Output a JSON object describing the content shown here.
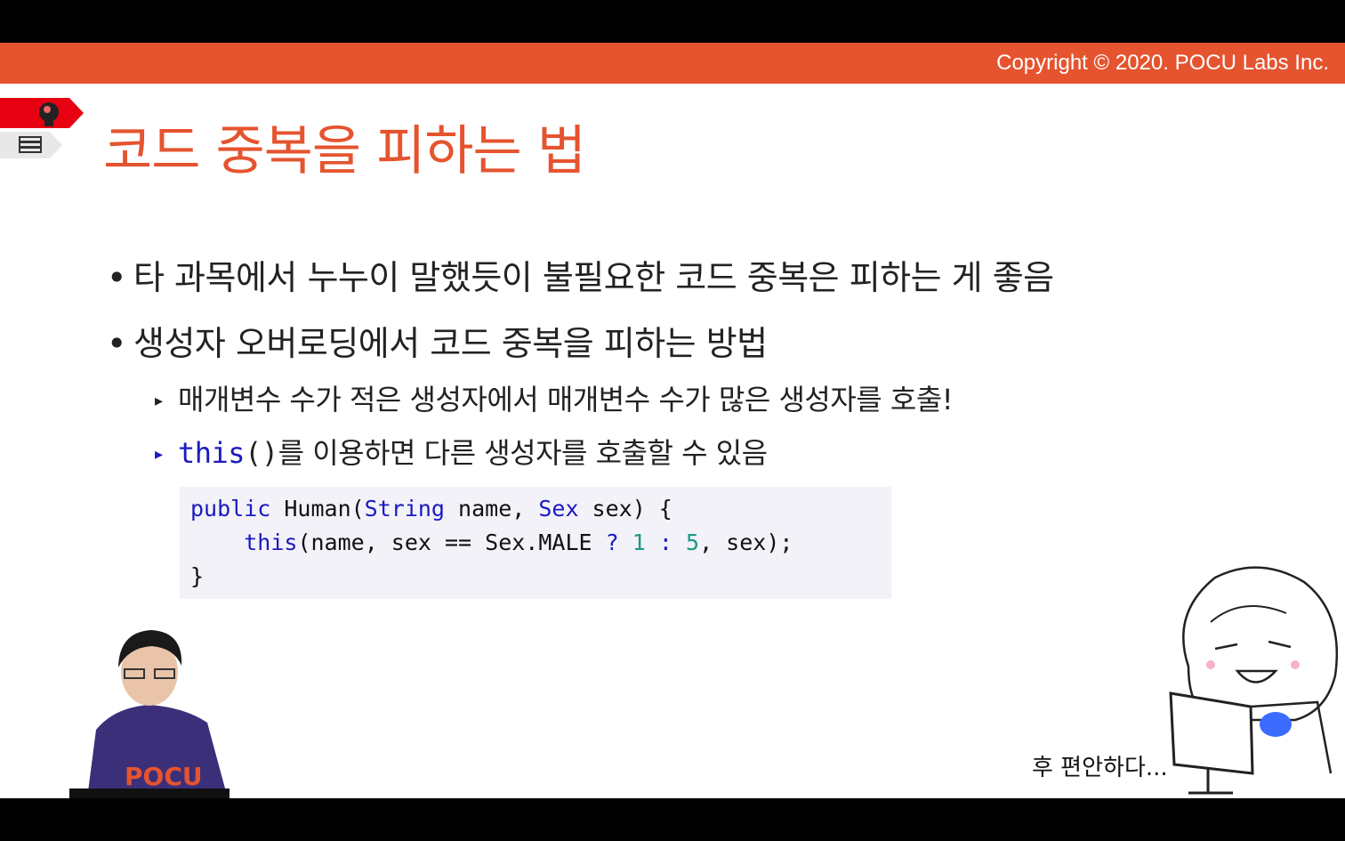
{
  "header": {
    "copyright": "Copyright © 2020. POCU Labs Inc."
  },
  "slide": {
    "title": "코드 중복을 피하는 법",
    "bullets": [
      {
        "text": "타 과목에서 누누이 말했듯이 불필요한 코드 중복은 피하는 게 좋음"
      },
      {
        "text": "생성자 오버로딩에서 코드 중복을 피하는 방법"
      }
    ],
    "sub_bullets": [
      {
        "text": "매개변수 수가 적은 생성자에서 매개변수 수가 많은 생성자를 호출!"
      },
      {
        "keyword": "this",
        "parens": "()",
        "text": "를 이용하면 다른 생성자를 호출할 수 있음"
      }
    ],
    "code": {
      "line1": {
        "kw": "public",
        "a": " Human(",
        "type1": "String",
        "b": " name, ",
        "type2": "Sex",
        "c": " sex) {"
      },
      "line2": {
        "indent": "    ",
        "kw": "this",
        "a": "(name, sex == Sex.MALE ",
        "op1": "?",
        "sp1": " ",
        "n1": "1",
        "sp2": " ",
        "op2": ":",
        "sp3": " ",
        "n2": "5",
        "b": ", sex);"
      },
      "line3": "}"
    },
    "caption": "후 편안하다..."
  },
  "colors": {
    "accent": "#e5542f",
    "code_bg": "#f2f2f8",
    "keyword": "#1a1ac0",
    "number": "#1a9a88"
  },
  "icons": {
    "tab1": "brain-head-icon",
    "tab2": "book-stack-icon"
  }
}
